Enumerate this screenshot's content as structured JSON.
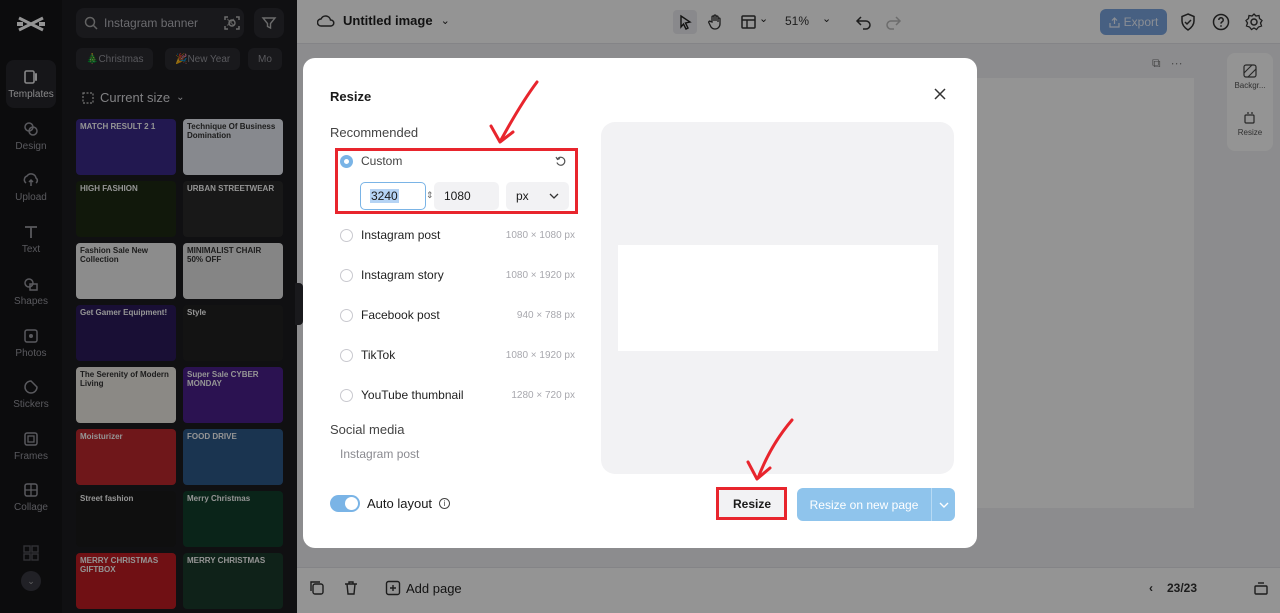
{
  "rail": {
    "items": [
      {
        "label": "Templates",
        "icon": "templates-icon"
      },
      {
        "label": "Design",
        "icon": "design-icon"
      },
      {
        "label": "Upload",
        "icon": "upload-icon"
      },
      {
        "label": "Text",
        "icon": "text-icon"
      },
      {
        "label": "Shapes",
        "icon": "shapes-icon"
      },
      {
        "label": "Photos",
        "icon": "photos-icon"
      },
      {
        "label": "Stickers",
        "icon": "stickers-icon"
      },
      {
        "label": "Frames",
        "icon": "frames-icon"
      },
      {
        "label": "Collage",
        "icon": "collage-icon"
      }
    ]
  },
  "panel": {
    "search_value": "Instagram banner",
    "chips": [
      "🎄Christmas",
      "🎉New Year",
      "Mo"
    ],
    "current_size": "Current size",
    "thumbs": [
      {
        "text": "MATCH RESULT 2 1",
        "bg": "#3b2a8a"
      },
      {
        "text": "Technique Of Business Domination",
        "bg": "#e9edf5"
      },
      {
        "text": "HIGH FASHION",
        "bg": "#1e2a14"
      },
      {
        "text": "URBAN STREETWEAR",
        "bg": "#2a2a2a"
      },
      {
        "text": "Fashion Sale New Collection",
        "bg": "#f1f1f1"
      },
      {
        "text": "MINIMALIST CHAIR 50% OFF",
        "bg": "#e6e6e6"
      },
      {
        "text": "Get Gamer Equipment!",
        "bg": "#2b1b5c"
      },
      {
        "text": "Style",
        "bg": "#222222"
      },
      {
        "text": "The Serenity of Modern Living",
        "bg": "#f0ece6"
      },
      {
        "text": "Super Sale CYBER MONDAY",
        "bg": "#4a1f8c"
      },
      {
        "text": "Moisturizer",
        "bg": "#c0282e"
      },
      {
        "text": "FOOD DRIVE",
        "bg": "#2d5a8a"
      },
      {
        "text": "Street fashion",
        "bg": "#1a1a1a"
      },
      {
        "text": "Merry Christmas",
        "bg": "#123f2c"
      },
      {
        "text": "MERRY CHRISTMAS GIFTBOX",
        "bg": "#c11d24"
      },
      {
        "text": "MERRY CHRISTMAS",
        "bg": "#1b3b2c"
      }
    ]
  },
  "topbar": {
    "doc_title": "Untitled image",
    "zoom": "51%",
    "export_label": "Export"
  },
  "rpanel": {
    "background_label": "Backgr...",
    "resize_label": "Resize"
  },
  "bottombar": {
    "add_page": "Add page",
    "page_count": "23/23"
  },
  "modal": {
    "title": "Resize",
    "recommended_label": "Recommended",
    "custom_label": "Custom",
    "width_value": "3240",
    "height_value": "1080",
    "unit": "px",
    "presets": [
      {
        "label": "Instagram post",
        "dims": "1080 × 1080 px"
      },
      {
        "label": "Instagram story",
        "dims": "1080 × 1920 px"
      },
      {
        "label": "Facebook post",
        "dims": "940 × 788 px"
      },
      {
        "label": "TikTok",
        "dims": "1080 × 1920 px"
      },
      {
        "label": "YouTube thumbnail",
        "dims": "1280 × 720 px"
      }
    ],
    "social_media_label": "Social media",
    "social_sub": "Instagram post",
    "auto_layout_label": "Auto layout",
    "auto_layout_on": true,
    "resize_button": "Resize",
    "resize_new_button": "Resize on new page"
  },
  "colors": {
    "accent": "#7ab4e6",
    "annotation_red": "#e8252d",
    "rail_bg": "#151518",
    "panel_bg": "#1c1c20"
  }
}
